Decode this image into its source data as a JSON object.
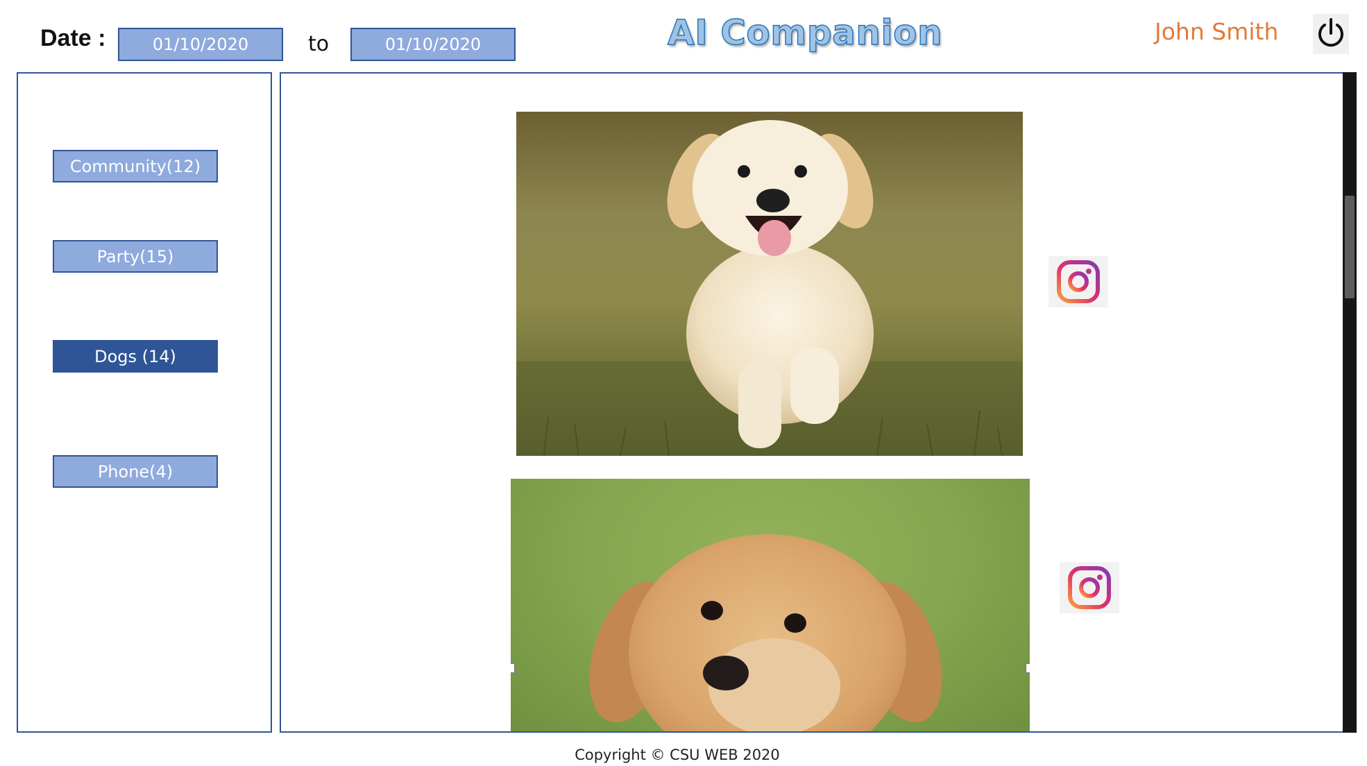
{
  "header": {
    "date_label": "Date :",
    "date_from": "01/10/2020",
    "to_label": "to",
    "date_to": "01/10/2020",
    "app_title": "AI Companion",
    "user_name": "John Smith",
    "power_icon": "power-icon"
  },
  "sidebar": {
    "categories": [
      {
        "label": "Community(12)",
        "active": false
      },
      {
        "label": "Party(15)",
        "active": false
      },
      {
        "label": "Dogs (14)",
        "active": true
      },
      {
        "label": "Phone(4)",
        "active": false
      }
    ]
  },
  "gallery": {
    "items": [
      {
        "subject": "golden retriever puppy running on grass",
        "share_icon": "instagram-icon"
      },
      {
        "subject": "golden retriever puppy face on green background",
        "share_icon": "instagram-icon"
      }
    ]
  },
  "footer": {
    "copyright": "Copyright © CSU WEB 2020"
  },
  "colors": {
    "accent": "#2f5597",
    "button_fill": "#8faadc",
    "title": "#9dc3e6",
    "user": "#e07b39"
  }
}
